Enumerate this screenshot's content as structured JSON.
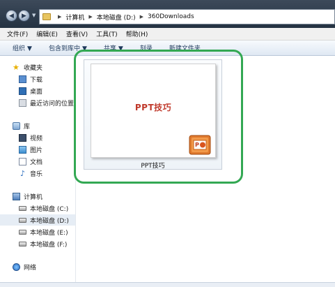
{
  "address": {
    "segments": [
      "计算机",
      "本地磁盘 (D:)",
      "360Downloads"
    ]
  },
  "menu": [
    "文件(F)",
    "编辑(E)",
    "查看(V)",
    "工具(T)",
    "帮助(H)"
  ],
  "toolbar": {
    "organize": "组织",
    "include_library": "包含到库中",
    "share": "共享",
    "burn": "刻录",
    "new_folder": "新建文件夹"
  },
  "sidebar": {
    "favorites": "收藏夹",
    "downloads": "下载",
    "desktop": "桌面",
    "recent": "最近访问的位置",
    "libraries": "库",
    "videos": "视频",
    "pictures": "图片",
    "documents": "文档",
    "music": "音乐",
    "computer": "计算机",
    "drive_c": "本地磁盘 (C:)",
    "drive_d": "本地磁盘 (D:)",
    "drive_e": "本地磁盘 (E:)",
    "drive_f": "本地磁盘 (F:)",
    "network": "网络"
  },
  "file": {
    "thumbnail_title": "PPT技巧",
    "name": "PPT技巧"
  },
  "colors": {
    "highlight": "#33a853",
    "thumb_title": "#c0392b"
  }
}
